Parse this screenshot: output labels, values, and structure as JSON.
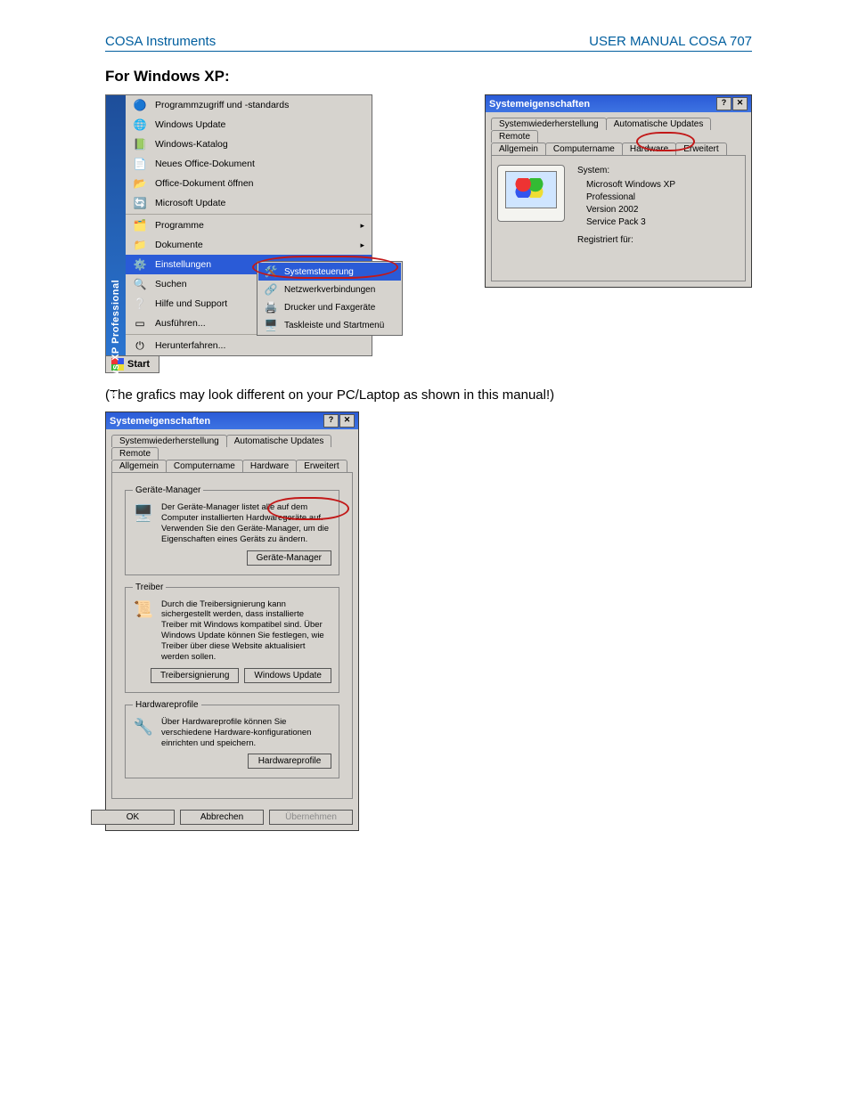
{
  "header": {
    "left": "COSA Instruments",
    "right": "USER MANUAL COSA 707"
  },
  "section_title": "For Windows XP:",
  "start_side": "Windows XP  Professional",
  "start_label": "Start",
  "start_items": {
    "i0": "Programmzugriff und -standards",
    "i1": "Windows Update",
    "i2": "Windows-Katalog",
    "i3": "Neues Office-Dokument",
    "i4": "Office-Dokument öffnen",
    "i5": "Microsoft Update",
    "i6": "Programme",
    "i7": "Dokumente",
    "i8": "Einstellungen",
    "i9": "Suchen",
    "i10": "Hilfe und Support",
    "i11": "Ausführen...",
    "i12": "Herunterfahren..."
  },
  "submenu": {
    "s0": "Systemsteuerung",
    "s1": "Netzwerkverbindungen",
    "s2": "Drucker und Faxgeräte",
    "s3": "Taskleiste und Startmenü"
  },
  "dlg1": {
    "title": "Systemeigenschaften",
    "tabs": {
      "t0": "Systemwiederherstellung",
      "t1": "Automatische Updates",
      "t2": "Remote",
      "t3": "Allgemein",
      "t4": "Computername",
      "t5": "Hardware",
      "t6": "Erweitert"
    },
    "sys_h": "System:",
    "sys_l1": "Microsoft Windows XP",
    "sys_l2": "Professional",
    "sys_l3": "Version 2002",
    "sys_l4": "Service Pack 3",
    "reg_h": "Registriert für:"
  },
  "note": "(The grafics may look different on your PC/Laptop as shown in this manual!)",
  "dlg2": {
    "title": "Systemeigenschaften",
    "tabs": {
      "t0": "Systemwiederherstellung",
      "t1": "Automatische Updates",
      "t2": "Remote",
      "t3": "Allgemein",
      "t4": "Computername",
      "t5": "Hardware",
      "t6": "Erweitert"
    },
    "g1_legend": "Geräte-Manager",
    "g1_text": "Der Geräte-Manager listet alle auf dem Computer installierten Hardwaregeräte auf. Verwenden Sie den Geräte-Manager, um die Eigenschaften eines Geräts zu ändern.",
    "g1_btn": "Geräte-Manager",
    "g2_legend": "Treiber",
    "g2_text": "Durch die Treibersignierung kann sichergestellt werden, dass installierte Treiber mit Windows kompatibel sind. Über Windows Update können Sie festlegen, wie Treiber über diese Website aktualisiert werden sollen.",
    "g2_btn1": "Treibersignierung",
    "g2_btn2": "Windows Update",
    "g3_legend": "Hardwareprofile",
    "g3_text": "Über Hardwareprofile können Sie verschiedene Hardware-konfigurationen einrichten und speichern.",
    "g3_btn": "Hardwareprofile",
    "ok": "OK",
    "cancel": "Abbrechen",
    "apply": "Übernehmen"
  }
}
